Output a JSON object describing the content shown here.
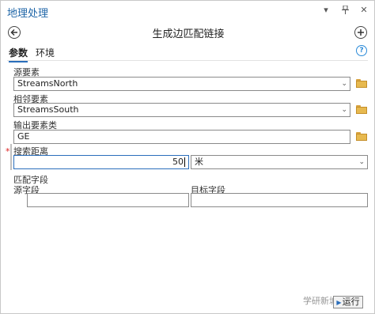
{
  "window": {
    "title": "地理处理"
  },
  "tool": {
    "title": "生成边匹配链接"
  },
  "tabs": [
    {
      "label": "参数"
    },
    {
      "label": "环境"
    }
  ],
  "help_label": "?",
  "params": {
    "source_features": {
      "label": "源要素",
      "value": "StreamsNorth"
    },
    "adjacent_features": {
      "label": "相邻要素",
      "value": "StreamsSouth"
    },
    "output_features": {
      "label": "输出要素类",
      "value": "GE"
    },
    "search_distance": {
      "label": "搜索距离",
      "value": "50",
      "unit": "米"
    },
    "match_fields": {
      "label": "匹配字段",
      "source_col": "源字段",
      "target_col": "目标字段"
    }
  },
  "required_marker": "*",
  "run_button": {
    "label": "运行"
  },
  "watermark": "学研新城"
}
